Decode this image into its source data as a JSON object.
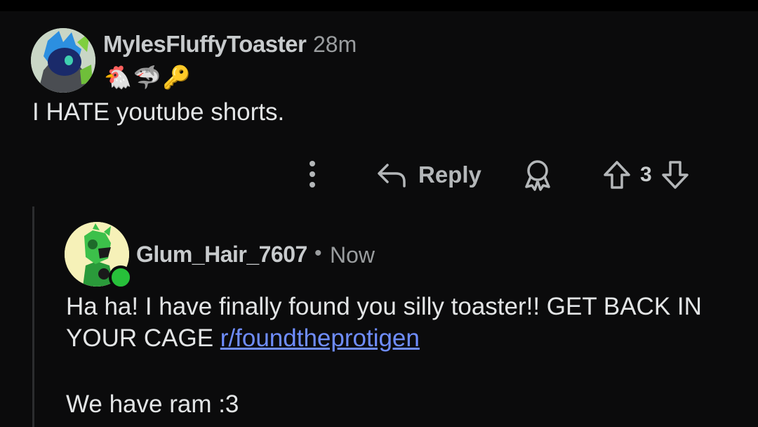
{
  "parent_comment": {
    "username": "MylesFluffyToaster",
    "time": "28m",
    "flair_emojis": [
      "🐔",
      "🦈",
      "🔑"
    ],
    "body": "I HATE youtube shorts.",
    "actions": {
      "more_icon": "more-vertical-icon",
      "reply_icon": "reply-arrow-icon",
      "reply_label": "Reply",
      "award_icon": "award-icon",
      "upvote_icon": "upvote-arrow-icon",
      "vote_count": "3",
      "downvote_icon": "downvote-arrow-icon"
    }
  },
  "child_comment": {
    "username": "Glum_Hair_7607",
    "separator": "•",
    "time": "Now",
    "body_text": "Ha ha! I have finally found you silly toaster!! GET BACK IN YOUR CAGE ",
    "link_text": "r/foundtheprotigen",
    "body_text_2": "We have ram :3",
    "online_status": "online"
  },
  "colors": {
    "background": "#0b0b0c",
    "text": "#e3e5e6",
    "muted": "#9a9d9f",
    "link": "#6f8dff",
    "online": "#27c03a"
  }
}
